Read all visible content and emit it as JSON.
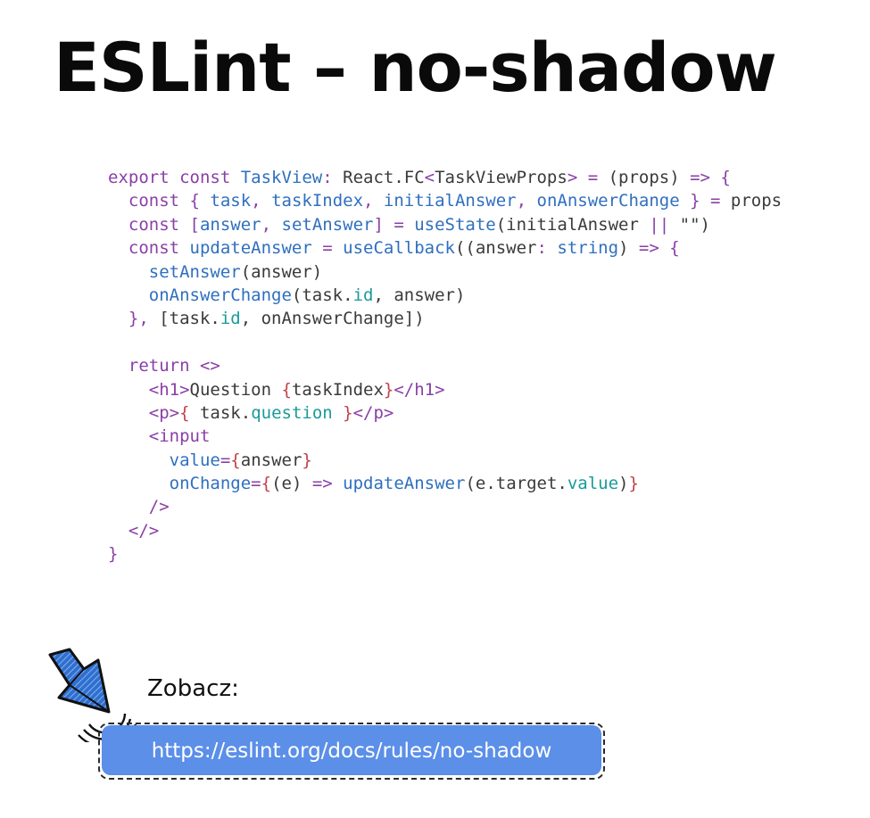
{
  "slide": {
    "title": "ESLint – no-shadow",
    "see_label": "Zobacz:",
    "link_url": "https://eslint.org/docs/rules/no-shadow"
  },
  "code": {
    "language": "tsx",
    "lines": [
      [
        [
          "kw",
          "export const "
        ],
        [
          "fn",
          "TaskView"
        ],
        [
          "op",
          ": "
        ],
        [
          "id",
          "React.FC"
        ],
        [
          "op",
          "<"
        ],
        [
          "id",
          "TaskViewProps"
        ],
        [
          "op",
          "> = "
        ],
        [
          "id",
          "(props) "
        ],
        [
          "op",
          "=> {"
        ]
      ],
      [
        [
          "kw",
          "  const "
        ],
        [
          "op",
          "{ "
        ],
        [
          "fn",
          "task"
        ],
        [
          "op",
          ", "
        ],
        [
          "fn",
          "taskIndex"
        ],
        [
          "op",
          ", "
        ],
        [
          "fn",
          "initialAnswer"
        ],
        [
          "op",
          ", "
        ],
        [
          "fn",
          "onAnswerChange"
        ],
        [
          "op",
          " } = "
        ],
        [
          "id",
          "props"
        ]
      ],
      [
        [
          "kw",
          "  const "
        ],
        [
          "op",
          "["
        ],
        [
          "fn",
          "answer"
        ],
        [
          "op",
          ", "
        ],
        [
          "fn",
          "setAnswer"
        ],
        [
          "op",
          "] = "
        ],
        [
          "fn",
          "useState"
        ],
        [
          "id",
          "(initialAnswer "
        ],
        [
          "op",
          "||"
        ],
        [
          "str",
          " \"\")"
        ]
      ],
      [
        [
          "kw",
          "  const "
        ],
        [
          "fn",
          "updateAnswer"
        ],
        [
          "op",
          " = "
        ],
        [
          "fn",
          "useCallback"
        ],
        [
          "id",
          "((answer"
        ],
        [
          "op",
          ": "
        ],
        [
          "fn",
          "string"
        ],
        [
          "id",
          ") "
        ],
        [
          "op",
          "=> {"
        ]
      ],
      [
        [
          "id",
          "    "
        ],
        [
          "fn",
          "setAnswer"
        ],
        [
          "id",
          "(answer)"
        ]
      ],
      [
        [
          "id",
          "    "
        ],
        [
          "fn",
          "onAnswerChange"
        ],
        [
          "id",
          "(task."
        ],
        [
          "pr",
          "id"
        ],
        [
          "id",
          ", answer)"
        ]
      ],
      [
        [
          "op",
          "  }, "
        ],
        [
          "id",
          "[task."
        ],
        [
          "pr",
          "id"
        ],
        [
          "id",
          ", onAnswerChange])"
        ]
      ],
      [
        [
          "id",
          ""
        ]
      ],
      [
        [
          "kw",
          "  return "
        ],
        [
          "op",
          "<>"
        ]
      ],
      [
        [
          "id",
          "    "
        ],
        [
          "op",
          "<h1>"
        ],
        [
          "id",
          "Question "
        ],
        [
          "br",
          "{"
        ],
        [
          "id",
          "taskIndex"
        ],
        [
          "br",
          "}"
        ],
        [
          "op",
          "</h1>"
        ]
      ],
      [
        [
          "id",
          "    "
        ],
        [
          "op",
          "<p>"
        ],
        [
          "br",
          "{"
        ],
        [
          "id",
          " task."
        ],
        [
          "pr",
          "question"
        ],
        [
          "id",
          " "
        ],
        [
          "br",
          "}"
        ],
        [
          "op",
          "</p>"
        ]
      ],
      [
        [
          "id",
          "    "
        ],
        [
          "op",
          "<input"
        ]
      ],
      [
        [
          "id",
          "      "
        ],
        [
          "fn",
          "value"
        ],
        [
          "op",
          "="
        ],
        [
          "br",
          "{"
        ],
        [
          "id",
          "answer"
        ],
        [
          "br",
          "}"
        ]
      ],
      [
        [
          "id",
          "      "
        ],
        [
          "fn",
          "onChange"
        ],
        [
          "op",
          "="
        ],
        [
          "br",
          "{"
        ],
        [
          "id",
          "(e) "
        ],
        [
          "op",
          "=>"
        ],
        [
          "id",
          " "
        ],
        [
          "fn",
          "updateAnswer"
        ],
        [
          "id",
          "(e.target."
        ],
        [
          "pr",
          "value"
        ],
        [
          "id",
          ")"
        ],
        [
          "br",
          "}"
        ]
      ],
      [
        [
          "id",
          "    "
        ],
        [
          "op",
          "/>"
        ]
      ],
      [
        [
          "id",
          "  "
        ],
        [
          "op",
          "</>"
        ]
      ],
      [
        [
          "op",
          "}"
        ]
      ]
    ]
  },
  "colors": {
    "keyword": "#8a3fa6",
    "function": "#2f6fbf",
    "property": "#1a9a9a",
    "brace": "#c2414a",
    "link_fill": "#5b8fe8",
    "link_text": "#ffffff"
  },
  "icons": {
    "pointer": "hand-drawn-arrow-cursor-icon"
  }
}
